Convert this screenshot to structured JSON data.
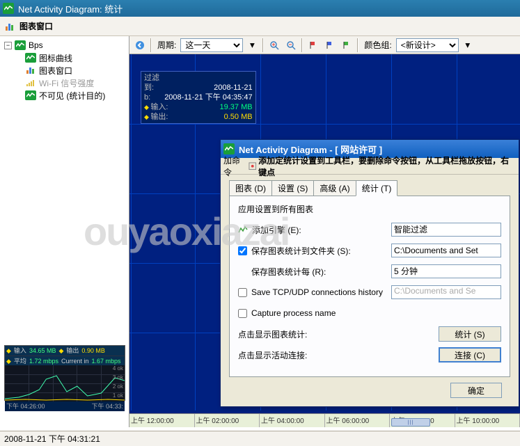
{
  "window": {
    "title": "Net Activity Diagram: 统计"
  },
  "subtoolbar": {
    "label": "图表窗口"
  },
  "tree": {
    "root": "Bps",
    "items": [
      {
        "label": "图标曲线"
      },
      {
        "label": "图表窗口"
      },
      {
        "label": "Wi-Fi 信号强度"
      },
      {
        "label": "不可见 (统计目的)"
      }
    ]
  },
  "chart_toolbar": {
    "period_label": "周期:",
    "period_value": "这一天",
    "colorgroup_label": "颜色组:",
    "colorgroup_value": "<新设计>"
  },
  "tooltip": {
    "title": "过滤",
    "rows": [
      {
        "label": "到:",
        "value": "2008-11-21"
      },
      {
        "label": "b:",
        "value": "2008-11-21 下午 04:35:47"
      },
      {
        "label": "输入:",
        "value": "19.37 MB",
        "value_class": "green-val",
        "dot": true
      },
      {
        "label": "输出:",
        "value": "0.50 MB",
        "value_class": "yellow-val",
        "dot": true
      }
    ]
  },
  "time_axis": [
    "上午 12:00:00",
    "上午 02:00:00",
    "上午 04:00:00",
    "上午 06:00:00",
    "上午 08:00:00",
    "上午 10:00:00"
  ],
  "mini": {
    "head": {
      "in_label": "输入",
      "in_val": "34.65 MB",
      "out_label": "输出",
      "out_val": "0.90 MB",
      "avg_label": "平均",
      "avg_val": "1.72 mbps",
      "cur_label": "Current in",
      "cur_val": "1.67 mbps"
    },
    "ylabels": [
      "4 ok",
      "3 ok",
      "2 ok",
      "1 ok"
    ],
    "foot": {
      "left": "下午 04:26:00",
      "right": "下午 04:33:"
    }
  },
  "statusbar": {
    "text": "2008-11-21 下午 04:31:21"
  },
  "dialog": {
    "title": "Net Activity Diagram - [ 网站许可 ]",
    "toolbar_text": "添加定统计设置到工具栏，要删除命令按钮，从工具栏拖放按钮，右键点",
    "toolbar_prefix": "加命令 ",
    "tabs": [
      {
        "label": "图表 (D)"
      },
      {
        "label": "设置 (S)"
      },
      {
        "label": "高级 (A)"
      },
      {
        "label": "统计 (T)",
        "active": true
      }
    ],
    "panel": {
      "apply_label": "应用设置到所有图表",
      "rows": {
        "engine": {
          "label": "添加引擎 (E):",
          "value": "智能过滤"
        },
        "savefolder": {
          "label": "保存图表统计到文件夹 (S):",
          "value": "C:\\Documents and Set"
        },
        "saveevery": {
          "label": "保存图表统计每 (R):",
          "value": "5 分钟"
        },
        "tcphistory": {
          "label": "Save TCP/UDP connections history",
          "value": "C:\\Documents and Se"
        },
        "capture": {
          "label": "Capture process name"
        },
        "showstats": {
          "label": "点击显示图表统计:",
          "button": "统计 (S)"
        },
        "showconn": {
          "label": "点击显示活动连接:",
          "button": "连接 (C)"
        }
      }
    },
    "ok_button": "确定"
  },
  "watermark": "ouyaoxiazai",
  "chart_data": {
    "type": "line",
    "title": "",
    "x": [
      "下午 04:26:00",
      "下午 04:33:"
    ],
    "series": [
      {
        "name": "输入",
        "values_note": "input traffic sparkline, peak mid-window",
        "color": "#40ffb0"
      },
      {
        "name": "输出",
        "values_note": "output traffic low throughout",
        "color": "#ffdd00"
      }
    ],
    "ylabels": [
      "1 ok",
      "2 ok",
      "3 ok",
      "4 ok"
    ],
    "totals": {
      "input": "34.65 MB",
      "output": "0.90 MB",
      "avg": "1.72 mbps",
      "current_in": "1.67 mbps"
    }
  }
}
